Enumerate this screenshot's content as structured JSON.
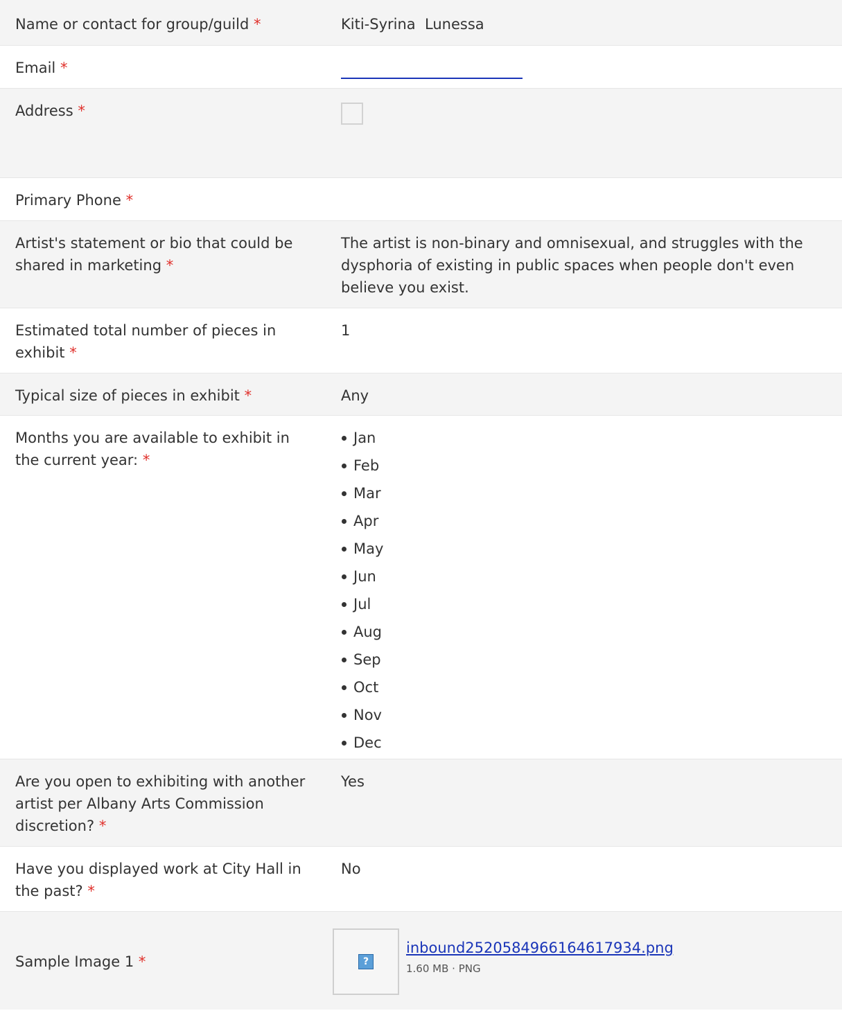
{
  "required_marker": "*",
  "fields": {
    "name": {
      "label": "Name or contact for group/guild",
      "value": "Kiti-Syrina  Lunessa"
    },
    "email": {
      "label": "Email",
      "value": ""
    },
    "address": {
      "label": "Address"
    },
    "phone": {
      "label": "Primary Phone",
      "value": ""
    },
    "bio": {
      "label": "Artist's statement or bio that could be shared in marketing",
      "value": "The artist is non-binary and omnisexual, and struggles with the dysphoria of existing in public spaces when people don't even believe you exist."
    },
    "pieces": {
      "label": "Estimated total number of pieces in exhibit",
      "value": "1"
    },
    "size": {
      "label": "Typical size of pieces in exhibit",
      "value": "Any"
    },
    "months": {
      "label": "Months you are available to exhibit in the current year:",
      "values": [
        "Jan",
        "Feb",
        "Mar",
        "Apr",
        "May",
        "Jun",
        "Jul",
        "Aug",
        "Sep",
        "Oct",
        "Nov",
        "Dec"
      ]
    },
    "shared": {
      "label": "Are you open to exhibiting with another artist per Albany Arts Commission discretion?",
      "value": "Yes"
    },
    "past": {
      "label": "Have you displayed work at City Hall in the past?",
      "value": "No"
    },
    "sample_image": {
      "label": "Sample Image 1",
      "file_name": "inbound2520584966164617934.png",
      "file_meta": "1.60 MB · PNG",
      "thumb_icon": "?"
    }
  },
  "colors": {
    "required": "#e0302b",
    "link": "#1a35b8",
    "row_alt": "#f4f4f4"
  }
}
